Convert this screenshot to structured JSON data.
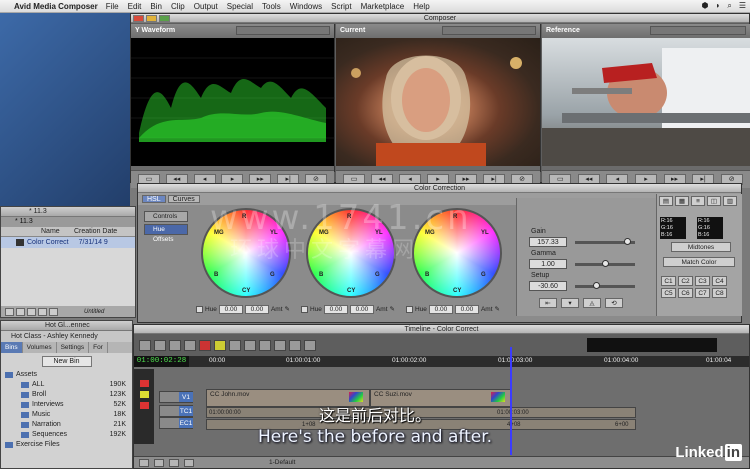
{
  "menubar": {
    "app": "Avid Media Composer",
    "items": [
      "File",
      "Edit",
      "Bin",
      "Clip",
      "Output",
      "Special",
      "Tools",
      "Windows",
      "Script",
      "Marketplace",
      "Help"
    ]
  },
  "composer": {
    "title": "Composer",
    "left_label": "Y Waveform",
    "center_label": "Current",
    "right_label": "Reference"
  },
  "bin": {
    "tab": "* 11.3",
    "title": "* 11.3",
    "col_name": "Name",
    "col_date": "Creation Date",
    "row_name": "Color Correct",
    "row_date": "7/31/14 9",
    "footer_label": "Untitled"
  },
  "project": {
    "title": "Hot Gl...ennec",
    "subtitle": "Hot Class - Ashley Kennedy",
    "tabs": [
      "Bins",
      "Volumes",
      "Settings",
      "For"
    ],
    "new_bin": "New Bin",
    "items": [
      {
        "name": "Assets",
        "size": ""
      },
      {
        "name": "ALL",
        "size": "190K"
      },
      {
        "name": "Broll",
        "size": "123K"
      },
      {
        "name": "Interviews",
        "size": "52K"
      },
      {
        "name": "Music",
        "size": "18K"
      },
      {
        "name": "Narration",
        "size": "21K"
      },
      {
        "name": "Sequences",
        "size": "192K"
      },
      {
        "name": "Exercise Files",
        "size": ""
      }
    ]
  },
  "color_correction": {
    "title": "Color Correction",
    "tab_hsl": "HSL",
    "tab_curves": "Curves",
    "controls": "Controls",
    "hue_offsets": "Hue Offsets",
    "wheel_letters": {
      "r": "R",
      "mg": "MG",
      "b": "B",
      "cy": "CY",
      "g": "G",
      "yl": "YL"
    },
    "hue_label": "Hue",
    "amt_label": "Amt",
    "wheel_values": [
      "0.00",
      "0.00",
      "0.00"
    ],
    "amt_values": [
      "0.00",
      "0.00",
      "0.00"
    ],
    "gain_label": "Gain",
    "gain_value": "157.33",
    "gain_level": 0.88,
    "gamma_label": "Gamma",
    "gamma_value": "1.00",
    "gamma_level": 0.5,
    "setup_label": "Setup",
    "setup_value": "-30.60",
    "setup_level": 0.35,
    "rgb_readout": [
      "R:16",
      "G:16",
      "B:16"
    ],
    "midtones": "Midtones",
    "match_color": "Match Color",
    "presets": [
      "C1",
      "C2",
      "C3",
      "C4",
      "C5",
      "C6",
      "C7",
      "C8"
    ]
  },
  "timeline": {
    "title": "Timeline - Color Correct",
    "timecode": "01:00:02:28",
    "ruler": [
      "00:00",
      "01:00:01:00",
      "01:00:02:00",
      "01:00:03:00",
      "01:00:04:00",
      "01:00:04"
    ],
    "tracks": [
      "V1",
      "TC1",
      "EC1"
    ],
    "clip1": "CC John.mov",
    "clip2": "CC Suzi.mov",
    "tc1_a": "01:00:00:00",
    "tc1_b": "01:00:03:00",
    "ec1_a": "1+08",
    "ec1_b": "4+08",
    "ec1_c": "6+00",
    "footer": "1-Default"
  },
  "subtitles": {
    "zh": "这是前后对比。",
    "en": "Here's the before and after."
  },
  "watermark": {
    "line1": "www.1741.cn",
    "line2": "环球中文字幕网"
  },
  "branding": {
    "linkedin_a": "Linked",
    "linkedin_b": "in"
  },
  "colors": {
    "accent_blue": "#4b68a8",
    "waveform_green": "#2fe02f",
    "timecode_green": "#4ee14e",
    "playhead": "#3b3bff"
  }
}
